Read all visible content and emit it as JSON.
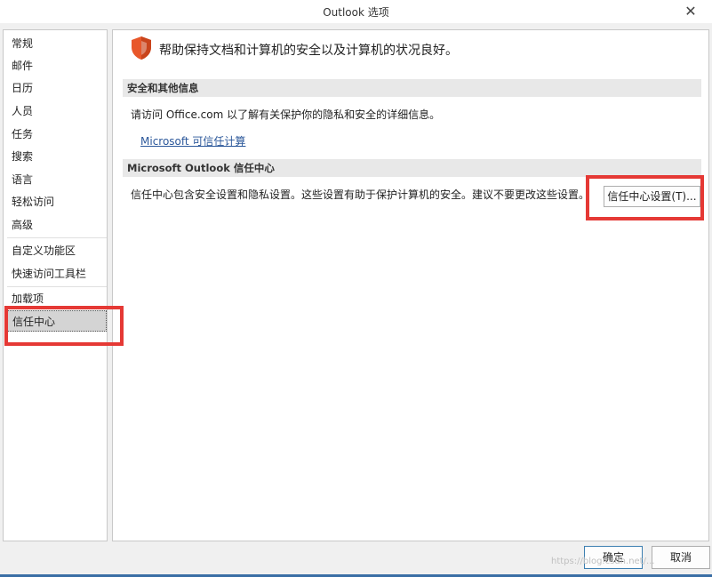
{
  "window": {
    "title": "Outlook 选项",
    "close_symbol": "✕"
  },
  "sidebar": {
    "items": [
      {
        "label": "常规"
      },
      {
        "label": "邮件"
      },
      {
        "label": "日历"
      },
      {
        "label": "人员"
      },
      {
        "label": "任务"
      },
      {
        "label": "搜索"
      },
      {
        "label": "语言"
      },
      {
        "label": "轻松访问"
      },
      {
        "label": "高级"
      },
      {
        "label": "自定义功能区"
      },
      {
        "label": "快速访问工具栏"
      },
      {
        "label": "加载项"
      },
      {
        "label": "信任中心"
      }
    ],
    "selected": "信任中心"
  },
  "main": {
    "banner": "帮助保持文档和计算机的安全以及计算机的状况良好。",
    "security_section": {
      "header": "安全和其他信息",
      "description": "请访问 Office.com 以了解有关保护你的隐私和安全的详细信息。",
      "link": "Microsoft 可信任计算"
    },
    "trust_center_section": {
      "header": "Microsoft Outlook 信任中心",
      "description": "信任中心包含安全设置和隐私设置。这些设置有助于保护计算机的安全。建议不要更改这些设置。",
      "button": "信任中心设置(T)..."
    }
  },
  "footer": {
    "ok": "确定",
    "cancel": "取消",
    "watermark": "https://blog.csdn.net/..."
  },
  "colors": {
    "highlight": "#e53935",
    "link": "#2b579a",
    "shield": "#e8572a"
  },
  "icons": {
    "shield": "shield-icon",
    "close": "close-icon"
  }
}
